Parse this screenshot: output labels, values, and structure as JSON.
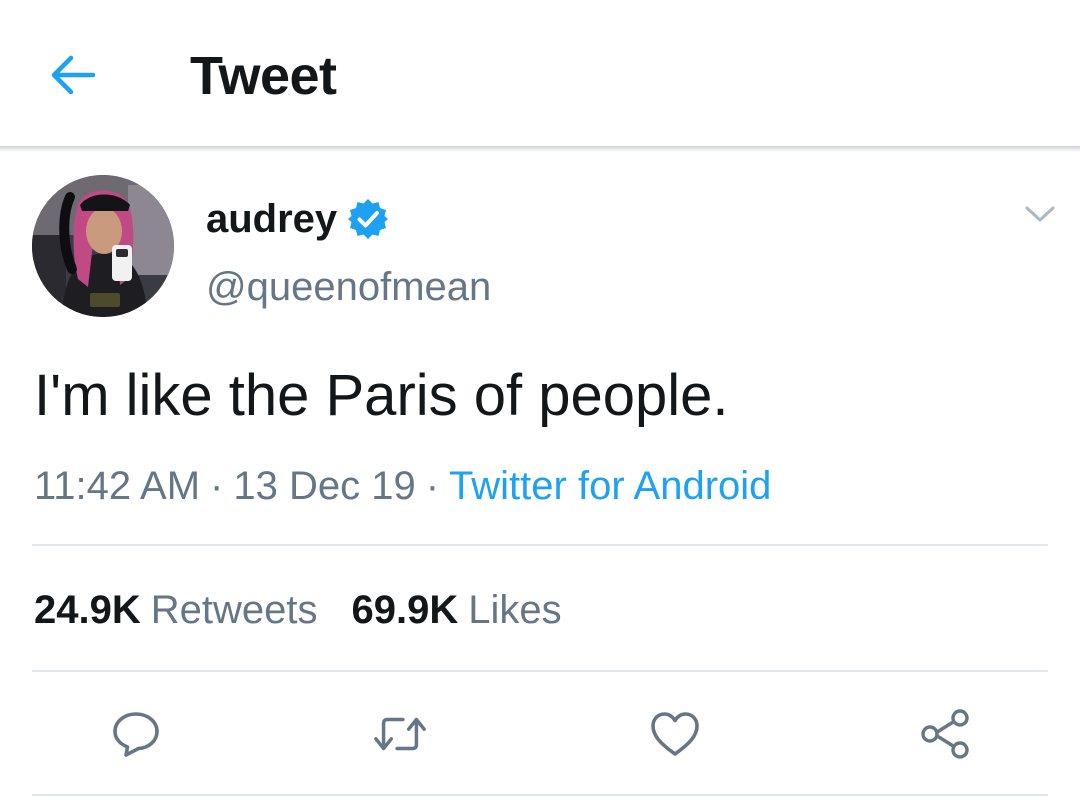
{
  "header": {
    "title": "Tweet",
    "back_icon": "arrow-left-icon"
  },
  "tweet": {
    "author": {
      "name": "audrey",
      "handle": "@queenofmean",
      "verified": true
    },
    "text": "I'm like the Paris of people.",
    "time": "11:42 AM",
    "date": "13 Dec 19",
    "separator": "·",
    "source": "Twitter for Android",
    "stats": {
      "retweets_count": "24.9K",
      "retweets_label": "Retweets",
      "likes_count": "69.9K",
      "likes_label": "Likes"
    }
  },
  "actions": [
    {
      "name": "reply",
      "icon": "comment-icon"
    },
    {
      "name": "retweet",
      "icon": "retweet-icon"
    },
    {
      "name": "like",
      "icon": "heart-icon"
    },
    {
      "name": "share",
      "icon": "share-icon"
    }
  ],
  "colors": {
    "accent": "#1da1f2",
    "text_primary": "#14171a",
    "text_secondary": "#657786",
    "divider": "#e1e8ed",
    "icon_gray": "#657786"
  }
}
